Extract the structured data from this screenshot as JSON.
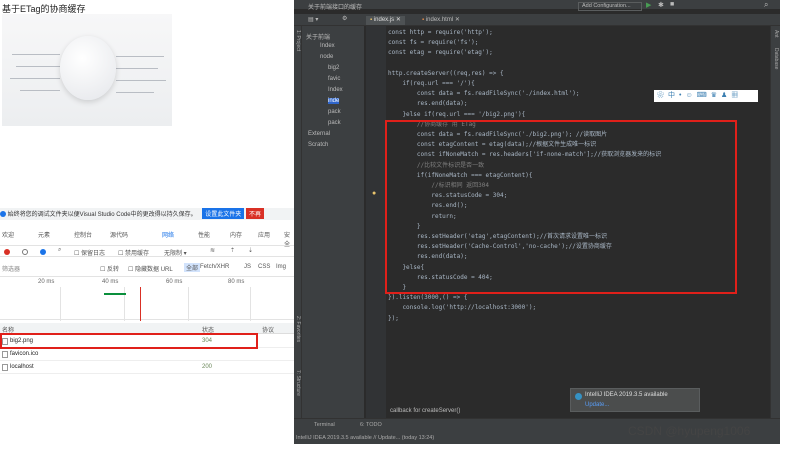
{
  "left_page": {
    "title": "基于ETag的协商缓存"
  },
  "devtools": {
    "notice_text": "始终将您的调试文件夹以便Visual Studio Code中的更改得以持久保存。",
    "notice_btn": "设置此文件夹",
    "notice_btn2": "不再",
    "tabs": [
      "欢迎",
      "元素",
      "控制台",
      "源代码",
      "网络",
      "性能",
      "内存",
      "应用",
      "安全"
    ],
    "toolbar": {
      "preserve_log": "保留日志",
      "disable_cache": "禁用缓存",
      "throttle": "无限制"
    },
    "filter": {
      "label": "筛选器",
      "invert": "反转",
      "hide_data": "隐藏数据 URL",
      "types": [
        "全部",
        "Fetch/XHR",
        "JS",
        "CSS",
        "Img"
      ]
    },
    "timeline_ticks": [
      "20 ms",
      "40 ms",
      "60 ms",
      "80 ms"
    ],
    "table": {
      "headers": [
        "名称",
        "状态",
        "协议"
      ],
      "rows": [
        {
          "name": "big2.png",
          "status": "304"
        },
        {
          "name": "favicon.ico",
          "status": ""
        },
        {
          "name": "localhost",
          "status": "200"
        }
      ]
    }
  },
  "ide": {
    "project_title": "关于前端接口的缓存",
    "run_config": "Add Configuration...",
    "tabs": [
      "index.js",
      "index.html"
    ],
    "project_tree": [
      "关于前端",
      "Index",
      "node",
      "big2",
      "favic",
      "Index",
      "inde",
      "pack",
      "pack",
      "External",
      "Scratch"
    ],
    "code_lines": [
      "const http = require('http');",
      "const fs = require('fs');",
      "const etag = require('etag');",
      "",
      "http.createServer((req,res) => {",
      "    if(req.url === '/'){",
      "        const data = fs.readFileSync('./index.html');",
      "        res.end(data);",
      "    }else if(req.url === '/big2.png'){",
      "        //协商缓存 用 ETag",
      "        const data = fs.readFileSync('./big2.png'); //读取图片",
      "        const etagContent = etag(data);//根据文件生成唯一标识",
      "        const ifNoneMatch = res.headers['if-none-match'];//获取浏览器发来的标识",
      "        //比较文件标识是否一致",
      "        if(ifNoneMatch === etagContent){",
      "            //标识相同 返回304",
      "            res.statusCode = 304;",
      "            res.end();",
      "            return;",
      "        }",
      "        res.setHeader('etag',etagContent);//首次请求设置唯一标识",
      "        res.setHeader('Cache-Control','no-cache');//设置协商缓存",
      "        res.end(data);",
      "    }else{",
      "        res.statusCode = 404;",
      "    }",
      "}).listen(3000,() => {",
      "    console.log('http://localhost:3000');",
      "});"
    ],
    "callback_text": "callback for createServer()",
    "toast_title": "IntelliJ IDEA 2019.3.5 available",
    "toast_link": "Update...",
    "bottom_tabs": [
      "Terminal",
      "6: TODO"
    ],
    "status_text": "IntelliJ IDEA 2019.3.5 available // Update... (today 13:24)",
    "side_labels": [
      "1: Project",
      "2: Favorites",
      "7: Structure",
      "Ant",
      "Database"
    ]
  },
  "watermark": "CSDN @hyupeng1006",
  "colors": {
    "highlight_box": "#e0201a",
    "ide_bg": "#2b2b2b",
    "ide_panel": "#3c3f41"
  }
}
